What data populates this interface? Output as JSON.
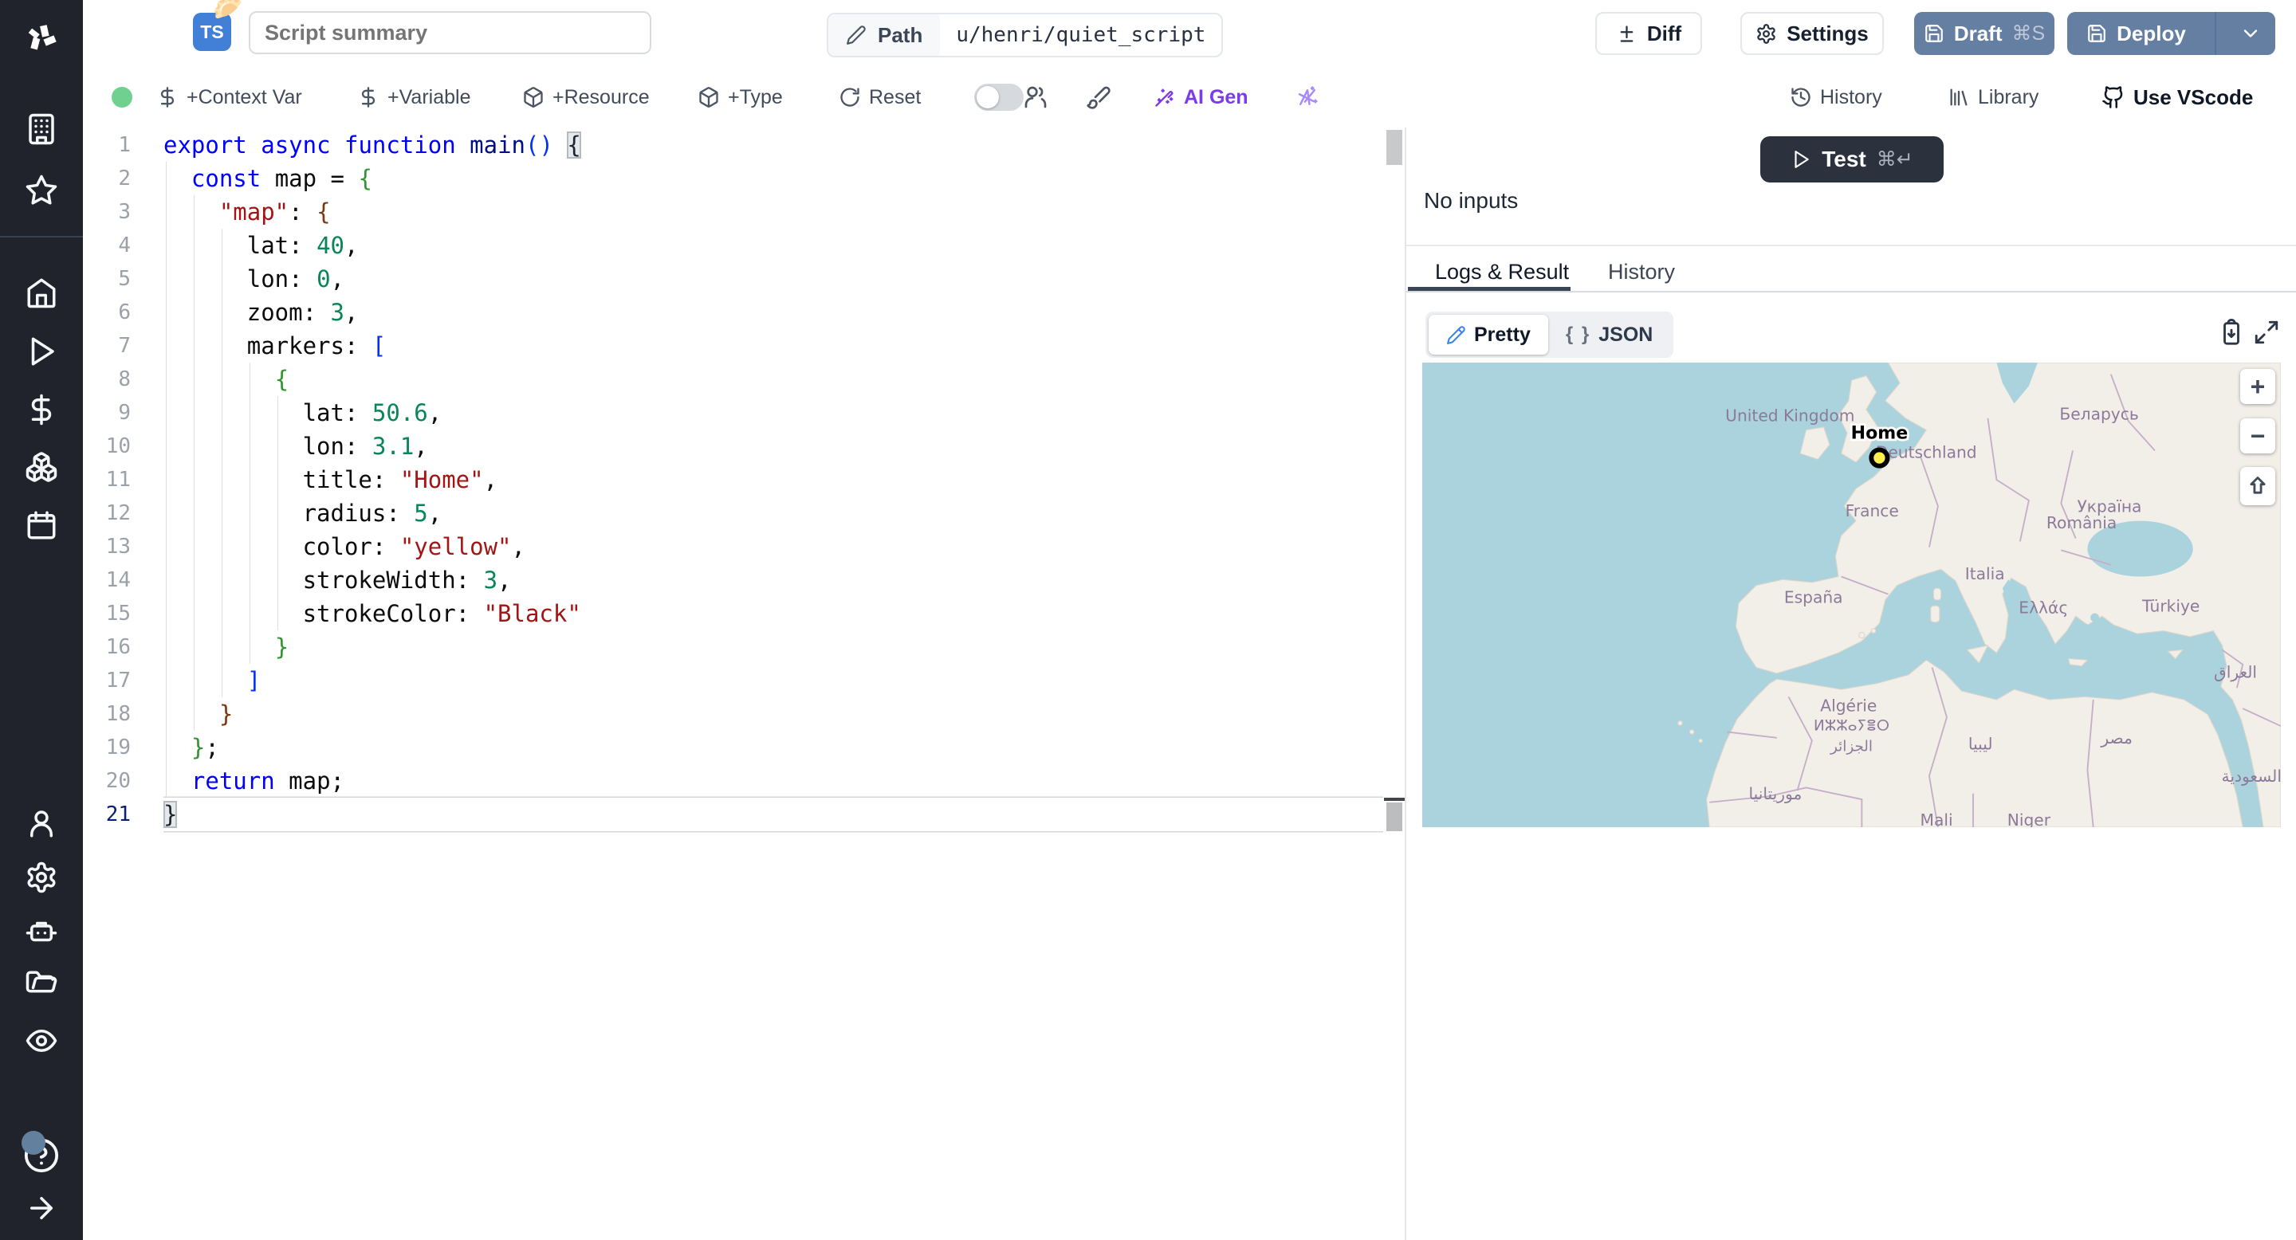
{
  "theme": {
    "sidebar_bg": "#20232b",
    "primary_button_bg": "#657fa3",
    "test_button_bg": "#2b313d",
    "ai_accent": "#7c3aed",
    "status_dot": "#6fd08f",
    "map_water": "#abd3de",
    "map_land": "#f2efe9"
  },
  "header": {
    "language_badge": "TS",
    "script_emoji": "🥟",
    "title_placeholder": "Script summary",
    "path_label": "Path",
    "path_value": "u/henri/quiet_script",
    "diff_label": "Diff",
    "settings_label": "Settings",
    "draft_label": "Draft",
    "draft_shortcut": "⌘S",
    "deploy_label": "Deploy"
  },
  "toolbar": {
    "context_var_label": "+Context Var",
    "variable_label": "+Variable",
    "resource_label": "+Resource",
    "type_label": "+Type",
    "reset_label": "Reset",
    "ai_gen_label": "AI Gen",
    "history_label": "History",
    "library_label": "Library",
    "vscode_label": "Use VScode"
  },
  "editor": {
    "lines": [
      [
        [
          "export",
          "kw"
        ],
        [
          " ",
          "pl"
        ],
        [
          "async",
          "kw"
        ],
        [
          " ",
          "pl"
        ],
        [
          "function",
          "kw"
        ],
        [
          " ",
          "pl"
        ],
        [
          "main",
          "fn"
        ],
        [
          "()",
          "b1"
        ],
        [
          " ",
          "pl"
        ],
        [
          "{",
          "b1 match"
        ]
      ],
      [
        [
          "  ",
          "pl"
        ],
        [
          "const",
          "kw"
        ],
        [
          " map = ",
          "pl"
        ],
        [
          "{",
          "b2"
        ]
      ],
      [
        [
          "    ",
          "pl"
        ],
        [
          "\"map\"",
          "str"
        ],
        [
          ": ",
          "pl"
        ],
        [
          "{",
          "b3"
        ]
      ],
      [
        [
          "      lat: ",
          "pl"
        ],
        [
          "40",
          "num"
        ],
        [
          ",",
          "pl"
        ]
      ],
      [
        [
          "      lon: ",
          "pl"
        ],
        [
          "0",
          "num"
        ],
        [
          ",",
          "pl"
        ]
      ],
      [
        [
          "      zoom: ",
          "pl"
        ],
        [
          "3",
          "num"
        ],
        [
          ",",
          "pl"
        ]
      ],
      [
        [
          "      markers: ",
          "pl"
        ],
        [
          "[",
          "b1"
        ]
      ],
      [
        [
          "        ",
          "pl"
        ],
        [
          "{",
          "b2"
        ]
      ],
      [
        [
          "          lat: ",
          "pl"
        ],
        [
          "50.6",
          "num"
        ],
        [
          ",",
          "pl"
        ]
      ],
      [
        [
          "          lon: ",
          "pl"
        ],
        [
          "3.1",
          "num"
        ],
        [
          ",",
          "pl"
        ]
      ],
      [
        [
          "          title: ",
          "pl"
        ],
        [
          "\"Home\"",
          "str"
        ],
        [
          ",",
          "pl"
        ]
      ],
      [
        [
          "          radius: ",
          "pl"
        ],
        [
          "5",
          "num"
        ],
        [
          ",",
          "pl"
        ]
      ],
      [
        [
          "          color: ",
          "pl"
        ],
        [
          "\"yellow\"",
          "str"
        ],
        [
          ",",
          "pl"
        ]
      ],
      [
        [
          "          strokeWidth: ",
          "pl"
        ],
        [
          "3",
          "num"
        ],
        [
          ",",
          "pl"
        ]
      ],
      [
        [
          "          strokeColor: ",
          "pl"
        ],
        [
          "\"Black\"",
          "str"
        ]
      ],
      [
        [
          "        ",
          "pl"
        ],
        [
          "}",
          "b2"
        ]
      ],
      [
        [
          "      ",
          "pl"
        ],
        [
          "]",
          "b1"
        ]
      ],
      [
        [
          "    ",
          "pl"
        ],
        [
          "}",
          "b3"
        ]
      ],
      [
        [
          "  ",
          "pl"
        ],
        [
          "}",
          "b2"
        ],
        [
          ";",
          "pl"
        ]
      ],
      [
        [
          "  ",
          "pl"
        ],
        [
          "return",
          "kw"
        ],
        [
          " map;",
          "pl"
        ]
      ],
      [
        [
          "}",
          "b1 match"
        ]
      ]
    ]
  },
  "run_panel": {
    "test_label": "Test",
    "test_shortcut": "⌘↵",
    "no_inputs_text": "No inputs",
    "tab_logs": "Logs & Result",
    "tab_history": "History",
    "pretty_label": "Pretty",
    "json_label": "JSON",
    "braces_glyph": "{ }"
  },
  "map": {
    "marker": {
      "title": "Home",
      "fill": "#fdee4f",
      "stroke": "#000000"
    },
    "zoom_in": "+",
    "zoom_out": "−",
    "labels": {
      "uk": "United Kingdom",
      "belarus": "Беларусь",
      "deutschland": "Deutschland",
      "france": "France",
      "ukraine": "Україна",
      "romania": "România",
      "italia": "Italia",
      "espana": "España",
      "ellas": "Ελλάς",
      "turkiye": "Türkiye",
      "iraq": "العراق",
      "algerie": "Algérie",
      "algerie_tifinagh": "ⵍⵣⵣⴰⵢⴻⵔ",
      "algerie_ar": "الجزائر",
      "libya_ar": "ليبيا",
      "egypt_ar": "مصر",
      "saudi_ar": "السعودية",
      "mauritania_ar": "موريتانيا",
      "mali": "Mali",
      "niger": "Niger"
    }
  }
}
